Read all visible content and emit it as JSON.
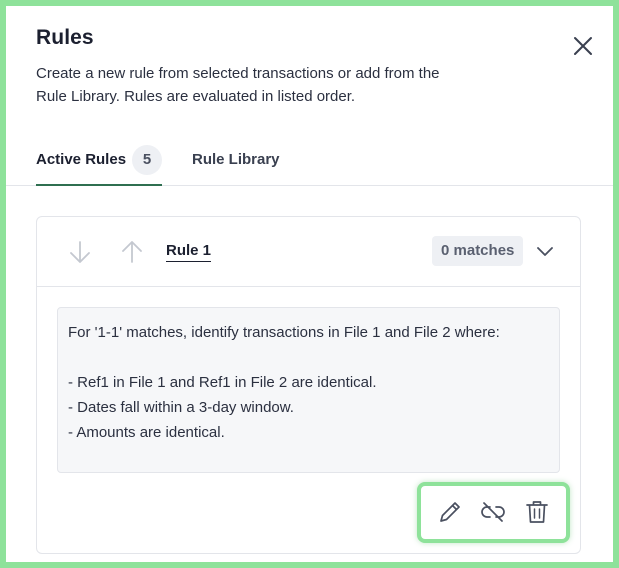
{
  "dialog": {
    "title": "Rules",
    "description": "Create a new rule from selected transactions or add from the Rule Library. Rules are evaluated in listed order."
  },
  "tabs": {
    "active": {
      "label": "Active Rules",
      "count": "5"
    },
    "library": {
      "label": "Rule Library"
    }
  },
  "rule": {
    "name": "Rule 1",
    "matches": "0 matches",
    "intro": "For '1-1' matches, identify transactions in File 1 and File 2 where:",
    "conditions": [
      "- Ref1 in File 1 and Ref1 in File 2 are identical.",
      "- Dates fall within a 3-day window.",
      "- Amounts are identical."
    ]
  },
  "icons": {
    "close": "close-icon",
    "move_down": "arrow-down-icon",
    "move_up": "arrow-up-icon",
    "expand": "chevron-down-icon",
    "edit": "pencil-icon",
    "unlink": "unlink-icon",
    "delete": "trash-icon"
  },
  "colors": {
    "highlight": "#8ee29a",
    "tab_underline": "#2f6f50",
    "badge_bg": "#eef0f4"
  }
}
